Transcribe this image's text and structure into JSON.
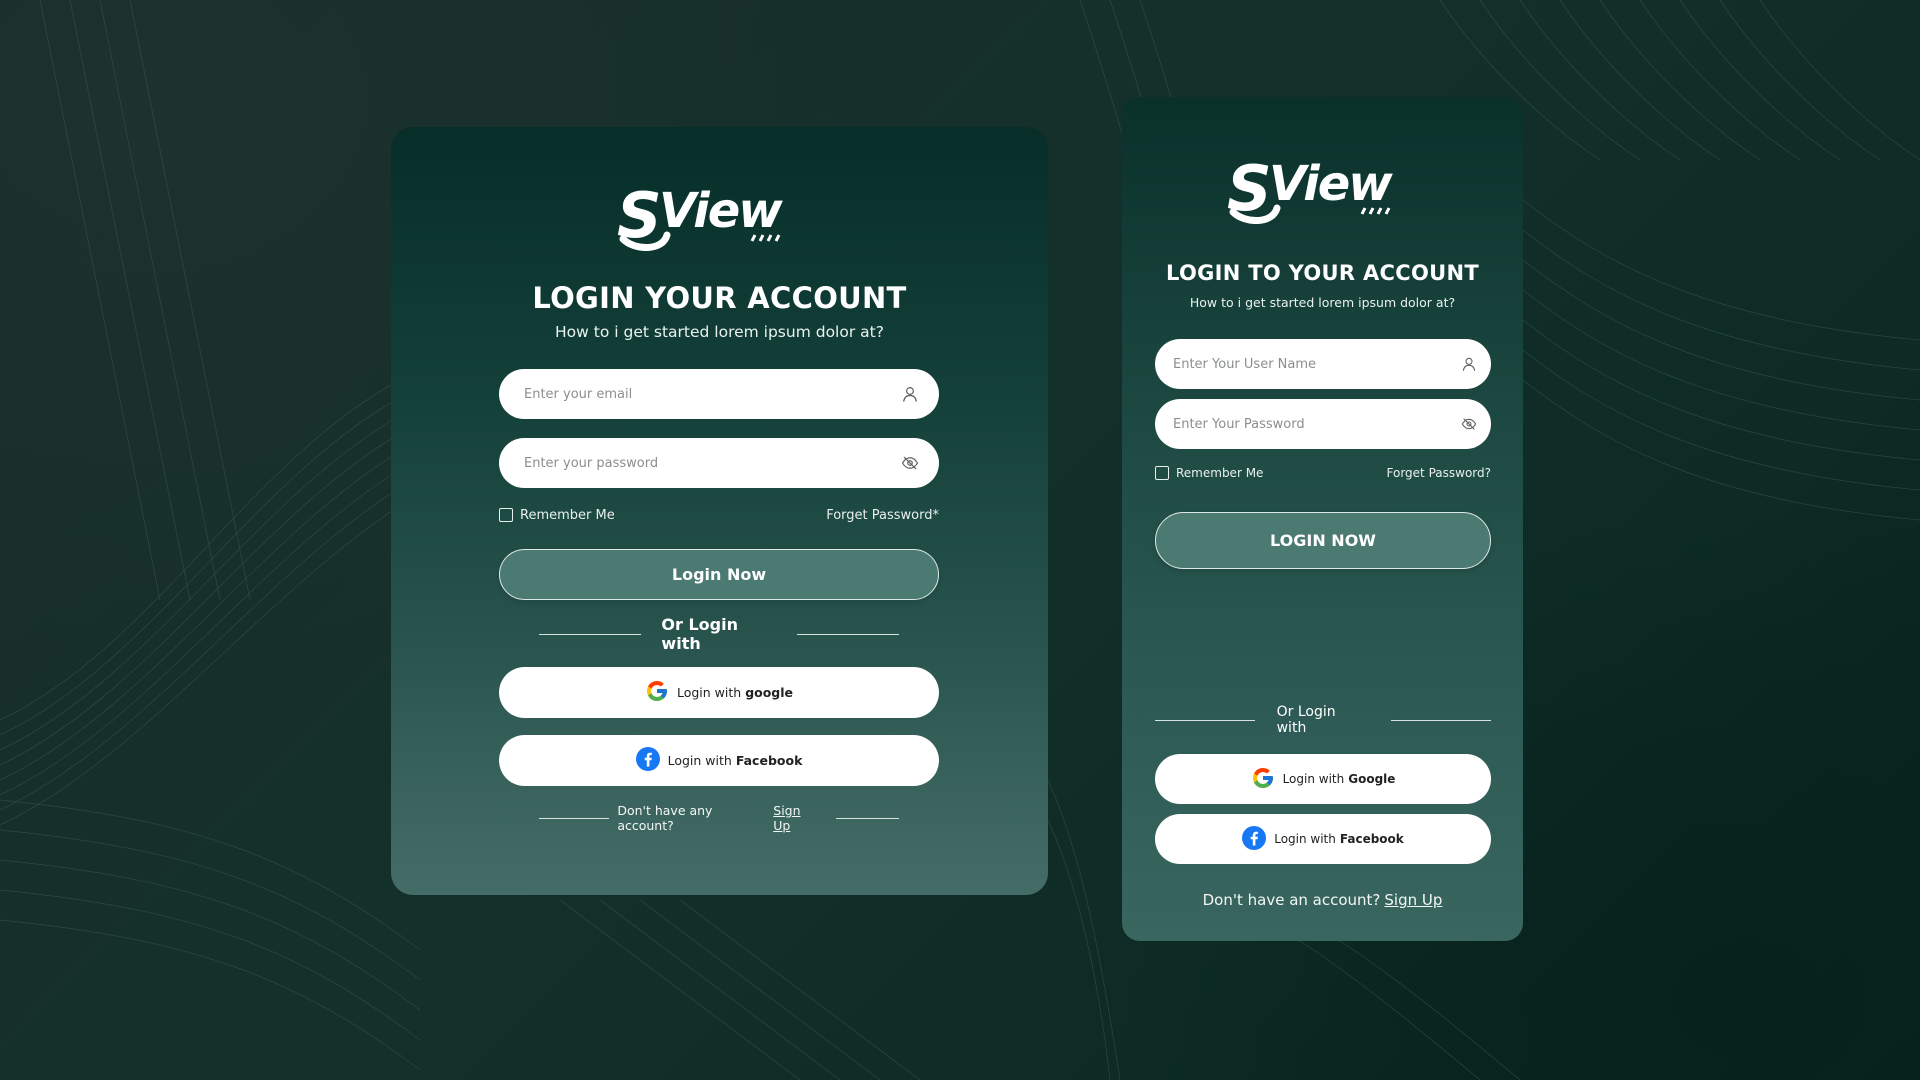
{
  "colors": {
    "card_dark": "#072e28",
    "card_light": "#456d67",
    "primary_button": "#4b7a72",
    "white": "#ffffff",
    "facebook_blue": "#1877f2"
  },
  "left_card": {
    "logo_text": "SView",
    "title": "LOGIN YOUR ACCOUNT",
    "subtitle": "How to i get started lorem ipsum dolor at?",
    "email_placeholder": "Enter your email",
    "email_icon": "user-icon",
    "password_placeholder": "Enter your password",
    "password_icon": "eye-off-icon",
    "remember_label": "Remember Me",
    "forgot_label": "Forget Password*",
    "login_button": "Login Now",
    "divider_text": "Or Login with",
    "google_prefix": "Login with",
    "google_brand": "google",
    "facebook_prefix": "Login with",
    "facebook_brand": "Facebook",
    "footer_text": "Don't have any account?",
    "footer_link": "Sign Up"
  },
  "right_card": {
    "logo_text": "SView",
    "title": "LOGIN TO YOUR ACCOUNT",
    "subtitle": "How to i get started lorem ipsum dolor at?",
    "username_placeholder": "Enter Your User Name",
    "username_icon": "user-icon",
    "password_placeholder": "Enter Your Password",
    "password_icon": "eye-off-icon",
    "remember_label": "Remember Me",
    "forgot_label": "Forget Password?",
    "login_button": "LOGIN NOW",
    "divider_text": "Or Login with",
    "google_prefix": "Login with",
    "google_brand": "Google",
    "facebook_prefix": "Login with",
    "facebook_brand": "Facebook",
    "footer_text": "Don't have an account?",
    "footer_link": "Sign Up"
  }
}
